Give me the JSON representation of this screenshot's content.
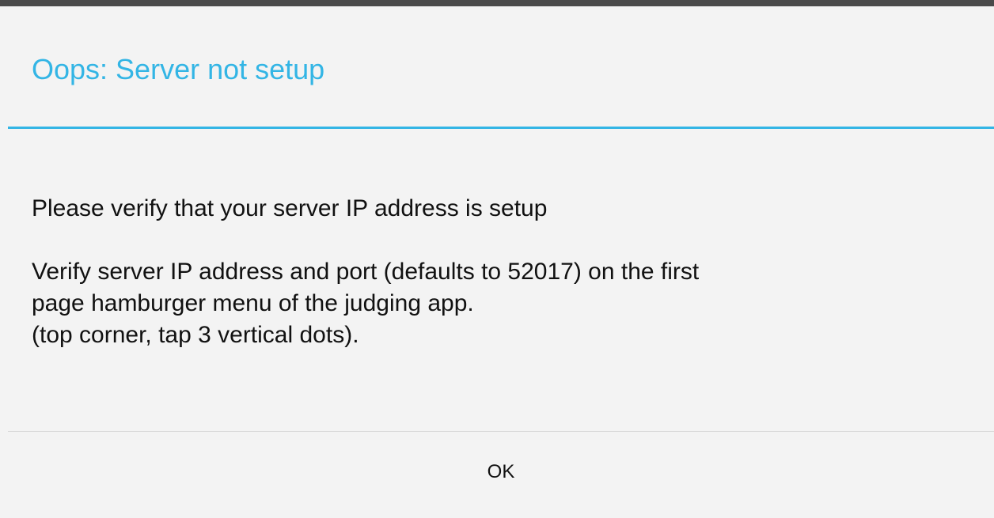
{
  "dialog": {
    "title": "Oops: Server not setup",
    "message_line1": "Please verify that your server IP address is setup",
    "message_line2a": "Verify server IP address and port (defaults to 52017) on the first",
    "message_line2b": "page hamburger menu of the judging app.",
    "message_line3": "(top corner, tap 3 vertical dots).",
    "ok_label": "OK"
  },
  "colors": {
    "accent": "#33b5e5",
    "background": "#f3f3f3",
    "status_bar": "#4a4a4a"
  }
}
